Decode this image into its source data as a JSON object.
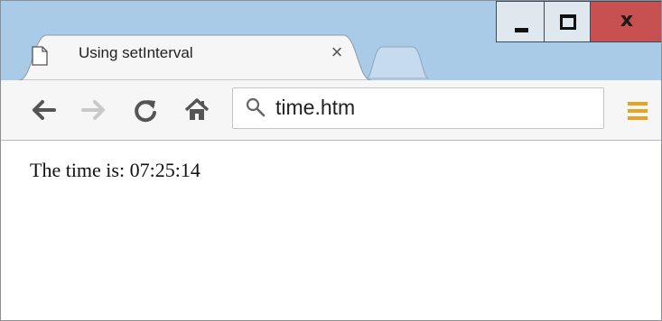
{
  "tab": {
    "title": "Using setInterval",
    "close_glyph": "×"
  },
  "window_controls": {
    "close_glyph": "x"
  },
  "toolbar": {
    "back_icon": "back-arrow-icon",
    "forward_icon": "forward-arrow-icon",
    "reload_icon": "reload-icon",
    "home_icon": "home-icon",
    "menu_icon": "hamburger-menu-icon"
  },
  "omnibox": {
    "value": "time.htm"
  },
  "page": {
    "label": "The time is: ",
    "time": "07:25:14"
  },
  "colors": {
    "titlebar": "#a9cbe8",
    "close_button": "#c75050",
    "menu_accent": "#e8a320"
  }
}
